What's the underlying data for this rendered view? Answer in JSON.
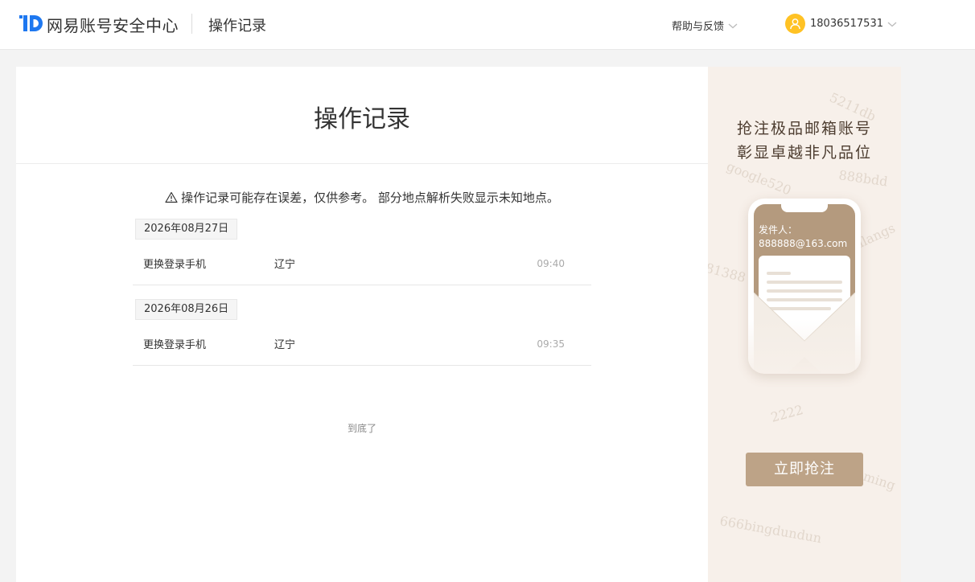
{
  "header": {
    "logo_text": "网易账号安全中心",
    "page_name": "操作记录",
    "help_label": "帮助与反馈",
    "user_phone": "18036517531"
  },
  "main": {
    "title": "操作记录",
    "notice": "操作记录可能存在误差，仅供参考。 部分地点解析失败显示未知地点。",
    "records": [
      {
        "date": "2026年08月27日",
        "action": "更换登录手机",
        "location": "辽宁",
        "time": "09:40"
      },
      {
        "date": "2026年08月26日",
        "action": "更换登录手机",
        "location": "辽宁",
        "time": "09:35"
      }
    ],
    "end_text": "到底了"
  },
  "ad": {
    "line1": "抢注极品邮箱账号",
    "line2": "彰显卓越非凡品位",
    "sender_label": "发件人：",
    "sender_email": "888888@163.com",
    "cta_label": "立即抢注",
    "watermarks": [
      "5211db",
      "888bdd",
      "google520",
      "81388",
      "llangs",
      "2222",
      "ming",
      "666bingdundun"
    ]
  },
  "colors": {
    "brand_blue": "#1e78f0",
    "avatar_yellow": "#ffc224",
    "ad_gold": "#bda387",
    "ad_background": "#f7f0ea"
  },
  "icons": {
    "logo": "netease-id-logo",
    "help_dropdown": "chevron-down-icon",
    "user": "user-avatar-icon",
    "notice": "warning-icon"
  }
}
